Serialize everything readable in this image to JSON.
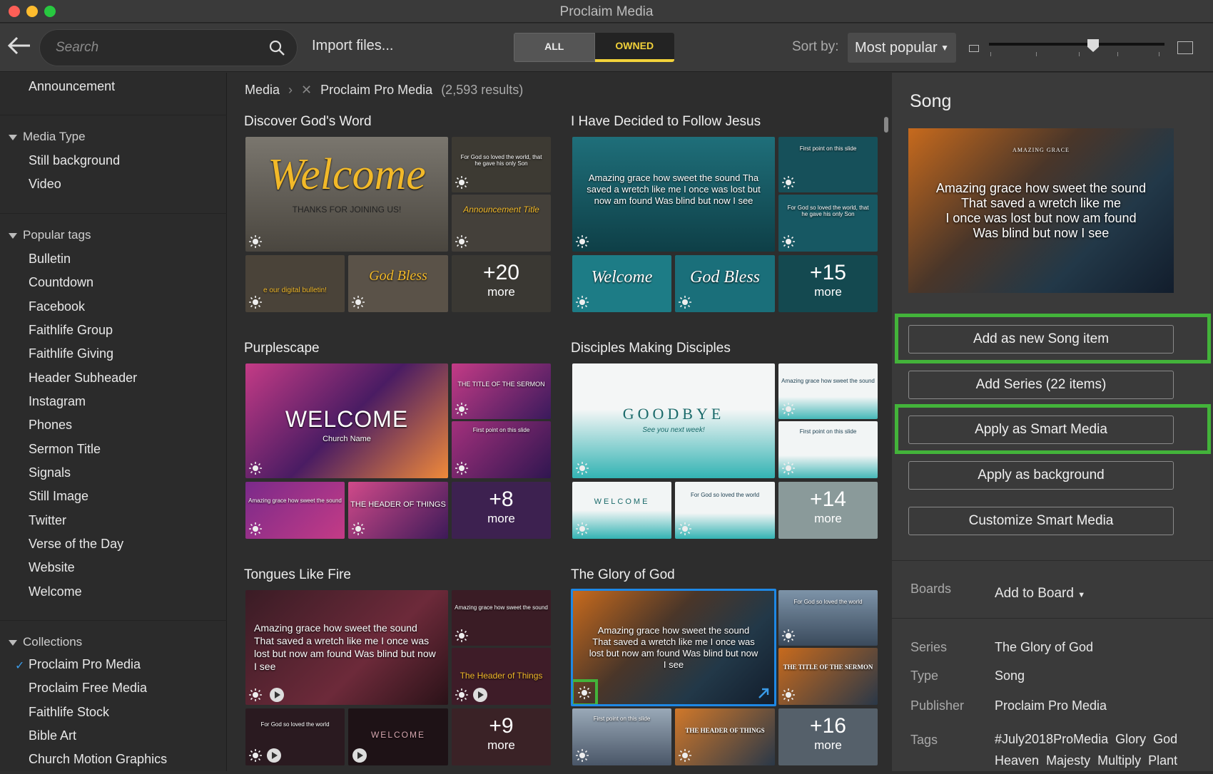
{
  "window": {
    "title": "Proclaim Media"
  },
  "toolbar": {
    "search_placeholder": "Search",
    "import_label": "Import files...",
    "filter_all": "ALL",
    "filter_owned": "OWNED",
    "sort_label": "Sort by:",
    "sort_value": "Most popular",
    "zoom_level": 0.6
  },
  "sidebar": {
    "top_item": "Announcement",
    "media_type": {
      "heading": "Media Type",
      "items": [
        "Still background",
        "Video"
      ]
    },
    "popular_tags": {
      "heading": "Popular tags",
      "items": [
        "Bulletin",
        "Countdown",
        "Facebook",
        "Faithlife Group",
        "Faithlife Giving",
        "Header Subheader",
        "Instagram",
        "Phones",
        "Sermon Title",
        "Signals",
        "Still Image",
        "Twitter",
        "Verse of the Day",
        "Website",
        "Welcome"
      ]
    },
    "collections": {
      "heading": "Collections",
      "items": [
        "Proclaim Pro Media",
        "Proclaim Free Media",
        "Faithlife Stock",
        "Bible Art",
        "Church Motion Graphics"
      ],
      "checked": "Proclaim Pro Media"
    }
  },
  "main": {
    "breadcrumb": {
      "root": "Media",
      "current": "Proclaim Pro Media",
      "results": "(2,593 results)"
    },
    "groups": [
      {
        "title": "Discover God's Word",
        "hero": "Welcome",
        "hero_sub": "THANKS FOR JOINING US!",
        "t1": "For God so loved the world, that he gave his only Son",
        "t2": "Announcement Title",
        "b1": "e our digital bulletin!",
        "b2": "God Bless",
        "more_count": "+20",
        "more_label": "more"
      },
      {
        "title": "I Have Decided to Follow Jesus",
        "hero": "Amazing grace how sweet the sound Tha saved a wretch like me I once was lost but now am found Was blind but now I see",
        "t1": "First point on this slide",
        "t2": "For God so loved the world, that he gave his only Son",
        "b1": "Welcome",
        "b2": "God Bless",
        "more_count": "+15",
        "more_label": "more"
      },
      {
        "title": "Purplescape",
        "hero": "WELCOME",
        "hero_sub": "Church Name",
        "t1": "THE TITLE OF THE SERMON",
        "t2": "First point on this slide",
        "b1": "Amazing grace how sweet the sound",
        "b2": "THE HEADER OF THINGS",
        "more_count": "+8",
        "more_label": "more"
      },
      {
        "title": "Disciples Making Disciples",
        "hero": "GOODBYE",
        "hero_sub": "See you next week!",
        "t1": "Amazing grace how sweet the sound",
        "t2": "First point on this slide",
        "b1": "WELCOME",
        "b2": "For God so loved the world",
        "more_count": "+14",
        "more_label": "more"
      },
      {
        "title": "Tongues Like Fire",
        "hero": "Amazing grace how sweet the sound That saved a wretch like me I once was lost but now am found Was blind but now I see",
        "t1": "Amazing grace how sweet the sound",
        "t2": "The Header of Things",
        "b1": "For God so loved the world",
        "b2": "WELCOME",
        "more_count": "+9",
        "more_label": "more"
      },
      {
        "title": "The Glory of God",
        "hero": "Amazing grace how sweet the sound That saved a wretch like me I once was lost but now am found Was blind but now I see",
        "t1": "For God so loved the world",
        "t2": "THE TITLE OF THE SERMON",
        "b1": "First point on this slide",
        "b2": "THE HEADER OF THINGS",
        "more_count": "+16",
        "more_label": "more"
      }
    ]
  },
  "panel": {
    "title": "Song",
    "preview_lines": [
      "Amazing grace how sweet the sound",
      "That saved a wretch like me",
      "I once was lost but now am found",
      "Was blind but now I see"
    ],
    "preview_header": "AMAZING GRACE",
    "buttons": [
      "Add as new Song item",
      "Add Series (22 items)",
      "Apply as Smart Media",
      "Apply as background",
      "Customize Smart Media"
    ],
    "boards_label": "Boards",
    "boards_value": "Add to Board",
    "series_label": "Series",
    "series_value": "The Glory of God",
    "type_label": "Type",
    "type_value": "Song",
    "publisher_label": "Publisher",
    "publisher_value": "Proclaim Pro Media",
    "tags_label": "Tags",
    "tags": [
      "#July2018ProMedia",
      "Glory",
      "God",
      "Heaven",
      "Majesty",
      "Multiply",
      "Plant"
    ]
  },
  "colors": {
    "highlight": "#43b33a",
    "selected": "#1e88e5",
    "owned": "#f2d23a"
  }
}
